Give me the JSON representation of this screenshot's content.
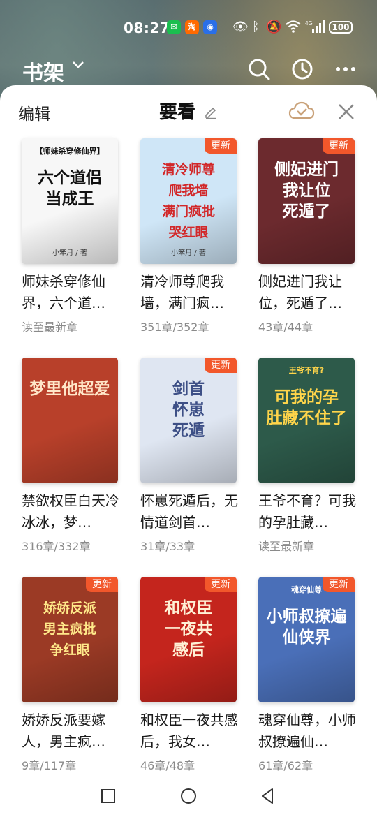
{
  "status": {
    "time": "08:27",
    "apps": [
      "wechat-icon",
      "taobao-icon",
      "bulb-icon"
    ],
    "taobao_text": "淘",
    "battery": "100"
  },
  "topbar": {
    "title": "书架"
  },
  "sheet": {
    "edit": "编辑",
    "title": "要看"
  },
  "books": [
    {
      "title": "师妹杀穿修仙界，六个道…",
      "progress": "读至最新章",
      "updated": false,
      "cover_text": "六个道侣\n当成王",
      "cover_top": "【师妹杀穿修仙界】",
      "cover_author": "小笨月 / 著",
      "bg": "#f7f7f7",
      "fg": "#111111"
    },
    {
      "title": "清冷师尊爬我墙，满门疯…",
      "progress": "351章/352章",
      "updated": true,
      "cover_text": "清冷师尊\n爬我墙\n满门疯批\n哭红眼",
      "cover_top": "",
      "cover_author": "小笨月 / 著",
      "bg": "#cfe6f7",
      "fg": "#d2282a"
    },
    {
      "title": "侧妃进门我让位，死遁了…",
      "progress": "43章/44章",
      "updated": true,
      "cover_text": "侧妃进门\n我让位\n死遁了",
      "cover_top": "",
      "cover_author": "",
      "bg": "#6c2a2e",
      "fg": "#ffffff"
    },
    {
      "title": "禁欲权臣白天冷冰冰，梦…",
      "progress": "316章/332章",
      "updated": false,
      "cover_text": "梦里他超爱",
      "cover_top": "",
      "cover_author": "",
      "bg": "#b8402a",
      "fg": "#ffe6c8"
    },
    {
      "title": "怀崽死遁后，无情道剑首…",
      "progress": "31章/33章",
      "updated": true,
      "cover_text": "剑首\n怀崽\n死遁",
      "cover_top": "",
      "cover_author": "",
      "bg": "#dfe6f2",
      "fg": "#3d4f86"
    },
    {
      "title": "王爷不育？可我的孕肚藏…",
      "progress": "读至最新章",
      "updated": false,
      "cover_text": "可我的孕\n肚藏不住了",
      "cover_top": "王爷不育?",
      "cover_author": "",
      "bg": "#2d5a4a",
      "fg": "#ffd54a"
    },
    {
      "title": "娇娇反派要嫁人，男主疯…",
      "progress": "9章/117章",
      "updated": true,
      "cover_text": "娇娇反派\n男主疯批\n争红眼",
      "cover_top": "",
      "cover_author": "",
      "bg": "#9b3a25",
      "fg": "#ffe98a"
    },
    {
      "title": "和权臣一夜共感后，我女…",
      "progress": "46章/48章",
      "updated": true,
      "cover_text": "和权臣\n一夜共\n感后",
      "cover_top": "",
      "cover_author": "",
      "bg": "#c4251d",
      "fg": "#fff1d6"
    },
    {
      "title": "魂穿仙尊，小师叔撩遍仙…",
      "progress": "61章/62章",
      "updated": true,
      "cover_text": "小师叔撩遍\n仙侠界",
      "cover_top": "魂穿仙尊",
      "cover_author": "",
      "bg": "#4a6fb8",
      "fg": "#ffffff"
    }
  ],
  "badge_label": "更新",
  "colors": {
    "accent": "#f2572b",
    "cloud": "#c9a27a"
  }
}
